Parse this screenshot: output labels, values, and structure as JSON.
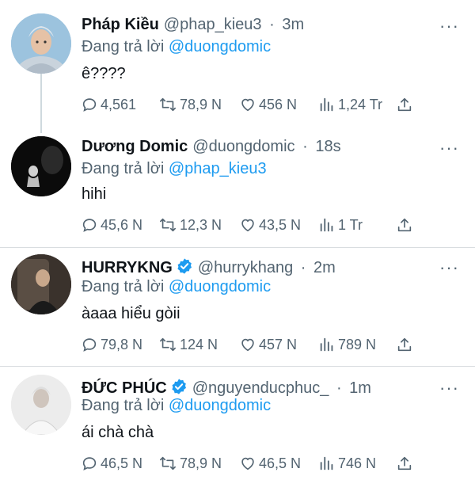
{
  "tweets": [
    {
      "name": "Pháp Kiều",
      "handle": "@phap_kieu3",
      "time": "3m",
      "separator": "·",
      "reply_prefix": "Đang trả lời",
      "reply_to": "@duongdomic",
      "text": "ê????",
      "replies": "4,561",
      "retweets": "78,9 N",
      "likes": "456 N",
      "views": "1,24 Tr",
      "verified": false
    },
    {
      "name": "Dương Domic",
      "handle": "@duongdomic",
      "time": "18s",
      "separator": "·",
      "reply_prefix": "Đang trả lời",
      "reply_to": "@phap_kieu3",
      "text": "hihi",
      "replies": "45,6 N",
      "retweets": "12,3 N",
      "likes": "43,5 N",
      "views": "1 Tr",
      "verified": false
    },
    {
      "name": "HURRYKNG",
      "handle": "@hurrykhang",
      "time": "2m",
      "separator": "·",
      "reply_prefix": "Đang trả lời",
      "reply_to": "@duongdomic",
      "text": "àaaa hiểu gòii",
      "replies": "79,8 N",
      "retweets": "124 N",
      "likes": "457 N",
      "views": "789 N",
      "verified": true
    },
    {
      "name": "ĐỨC PHÚC",
      "handle": "@nguyenducphuc_",
      "time": "1m",
      "separator": "·",
      "reply_prefix": "Đang trả lời",
      "reply_to": "@duongdomic",
      "text": "ái chà chà",
      "replies": "46,5 N",
      "retweets": "78,9 N",
      "likes": "46,5 N",
      "views": "746 N",
      "verified": true
    }
  ],
  "colors": {
    "accent": "#1d9bf0",
    "muted": "#536471",
    "text": "#0f1419"
  },
  "icons": [
    "more-icon",
    "reply-icon",
    "retweet-icon",
    "like-icon",
    "views-icon",
    "share-icon",
    "verified-icon"
  ]
}
